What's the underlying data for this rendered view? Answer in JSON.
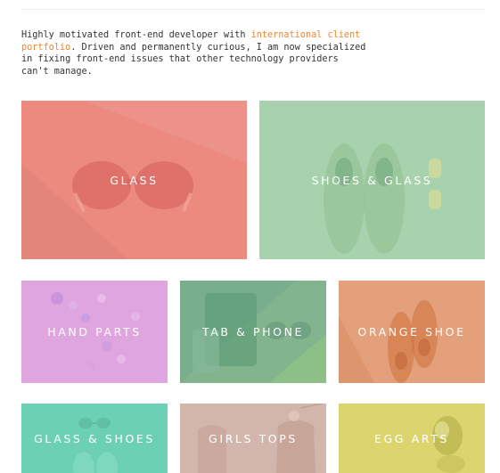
{
  "intro": {
    "text_before": "Highly motivated front-end developer with ",
    "link_text": "international client portfolio",
    "text_after": ". Driven and permanently curious, I am now specialized in fixing front-end issues that other technology providers can't manage.",
    "link_color": "#f0862a"
  },
  "portfolio": {
    "tiles": [
      {
        "label": "GLASS",
        "color": "#ec8a80"
      },
      {
        "label": "SHOES & GLASS",
        "color": "#a8d1ae"
      },
      {
        "label": "HAND PARTS",
        "color": "#dea5df"
      },
      {
        "label": "TAB & PHONE",
        "color": "#82b48e"
      },
      {
        "label": "ORANGE SHOE",
        "color": "#e3a07a"
      },
      {
        "label": "GLASS & SHOES",
        "color": "#6cd0b4"
      },
      {
        "label": "GIRLS TOPS",
        "color": "#d3b6ab"
      },
      {
        "label": "EGG ARTS",
        "color": "#dcd56d"
      }
    ]
  }
}
